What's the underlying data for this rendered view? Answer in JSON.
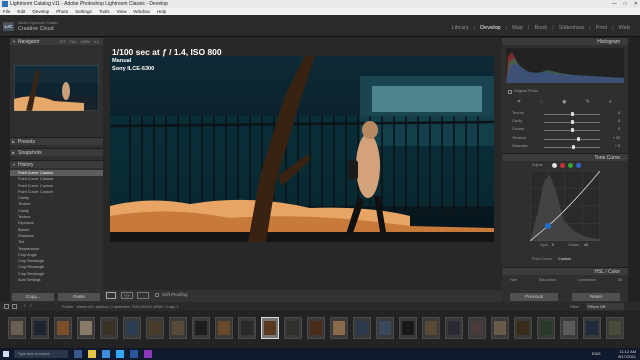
{
  "window": {
    "title": "Lightroom Catalog v11 - Adobe Photoshop Lightroom Classic - Develop",
    "controls": [
      "—",
      "□",
      "✕"
    ]
  },
  "menu": [
    "File",
    "Edit",
    "Develop",
    "Photo",
    "Settings",
    "Tools",
    "View",
    "Window",
    "Help"
  ],
  "identity": {
    "badge": "LrC",
    "line1": "Adobe Lightroom Classic",
    "line2": "Creative Cloud"
  },
  "modules": [
    "Library",
    "Develop",
    "Map",
    "Book",
    "Slideshow",
    "Print",
    "Web"
  ],
  "active_module": "Develop",
  "left_panel": {
    "navigator": {
      "label": "Navigator",
      "options": [
        "FIT",
        "FILL",
        "100%",
        "1:1"
      ]
    },
    "presets": "Presets",
    "snapshots": "Snapshots",
    "history": {
      "label": "History",
      "items": [
        "Point Curve: Custom",
        "Point Curve: Custom",
        "Point Curve: Custom",
        "Point Curve: Custom",
        "Clarity",
        "Texture",
        "Clarity",
        "Texture",
        "Exposure",
        "Blacks",
        "Shadows",
        "Tint",
        "Temperature",
        "Crop Angle",
        "Crop Rectangle",
        "Crop Rectangle",
        "Crop Rectangle",
        "Auto Settings"
      ],
      "selected_index": 0
    },
    "copy_button": "Copy...",
    "paste_button": "Paste"
  },
  "photo": {
    "exposure": "1/100 sec at ƒ / 1.4, ISO 800",
    "mode": "Manual",
    "camera": "Sony ILCE-6300"
  },
  "toolbar": {
    "soft_proofing": "Soft Proofing"
  },
  "right_panel": {
    "histogram": "Histogram",
    "original_photo": "Original Photo",
    "sliders": [
      {
        "label": "Texture",
        "value": "0",
        "pos": 0.5
      },
      {
        "label": "Clarity",
        "value": "0",
        "pos": 0.5
      },
      {
        "label": "Dehaze",
        "value": "0",
        "pos": 0.5
      },
      {
        "label": "Vibrance",
        "value": "+ 20",
        "pos": 0.62
      },
      {
        "label": "Saturation",
        "value": "+ 5",
        "pos": 0.53
      }
    ],
    "tone_curve": "Tone Curve",
    "adjust": "Adjust",
    "curve_readout": {
      "input_label": "Input",
      "input": "0",
      "output_label": "Output",
      "output": "43"
    },
    "point_curve": {
      "label": "Point Curve",
      "value": "Custom"
    },
    "hsl": "HSL / Color",
    "hsl_tabs": [
      "Hue",
      "Saturation",
      "Luminance",
      "All"
    ],
    "previous_button": "Previous",
    "reset_button": "Reset"
  },
  "filmstrip": {
    "info": "Folder : street    421 photos / 1 selected / DSC00421.ARW / Copy 1",
    "filter_label": "Filter :",
    "filter_value": "Filters Off",
    "thumb_colors": [
      "#6a5d52",
      "#1c2430",
      "#7a4f2a",
      "#8a7a68",
      "#3b3226",
      "#2e3e52",
      "#4a3a2a",
      "#58493a",
      "#1e1e1e",
      "#6a4a2a",
      "#2a2a2a",
      "#5a3a20",
      "#30302a",
      "#4a2a18",
      "#8a6a4a",
      "#2a3a4a",
      "#3a4a5a",
      "#1a1a1a",
      "#5a4a3a",
      "#2a2a36",
      "#4a3a3a",
      "#6a5a4a",
      "#3a2a1a",
      "#2a3a2a",
      "#5a5a5a",
      "#1e2a3a",
      "#4a4a3a"
    ]
  },
  "taskbar": {
    "search": "Type here to search",
    "time": "11:12 AM",
    "date": "8/17/2021",
    "lang": "ENG"
  }
}
